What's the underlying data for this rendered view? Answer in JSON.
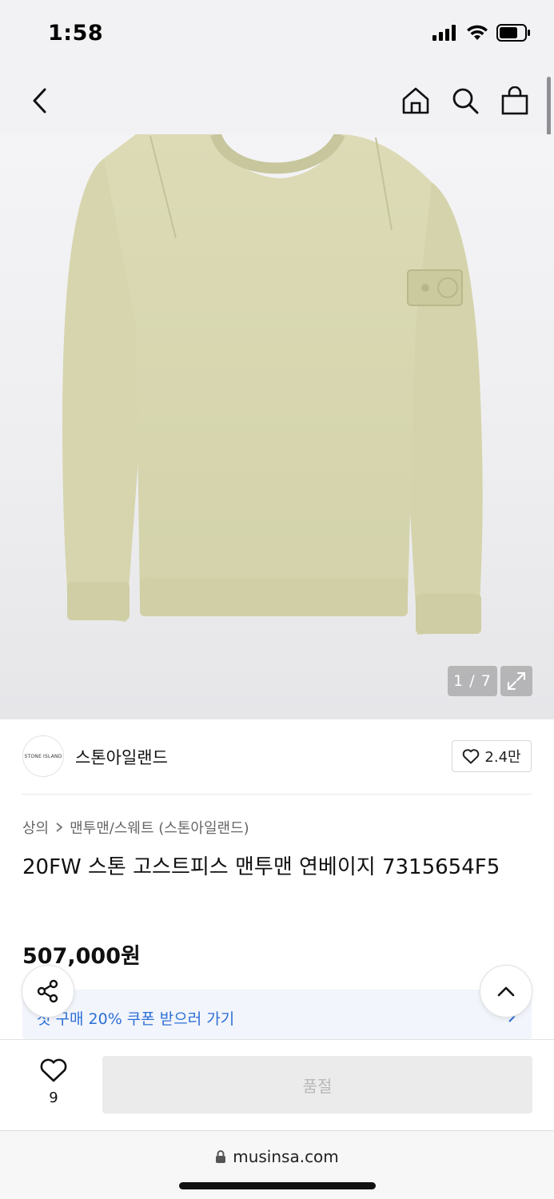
{
  "status": {
    "time": "1:58",
    "icons": [
      "signal-icon",
      "wifi-icon",
      "battery-icon"
    ]
  },
  "nav": {
    "icons": [
      "back-icon",
      "home-icon",
      "search-icon",
      "shopping-bag-icon"
    ]
  },
  "gallery": {
    "counter": "1 / 7",
    "current_image": 1,
    "total_images": 7,
    "product_color": "#dddcb8"
  },
  "brand": {
    "logo_text": "STONE ISLAND",
    "name": "스톤아일랜드",
    "likes": "2.4만"
  },
  "breadcrumb": {
    "category": "상의",
    "subcategory": "맨투맨/스웨트 (스톤아일랜드)"
  },
  "product": {
    "title": "20FW 스톤 고스트피스 맨투맨 연베이지 7315654F5",
    "price": "507,000원"
  },
  "coupon": {
    "text": "첫 구매 20% 쿠폰 받으러 가기"
  },
  "bottom": {
    "wish_count": "9",
    "buy_button": "품절"
  },
  "browser": {
    "url": "musinsa.com"
  },
  "colors": {
    "accent_blue": "#2c6fd6",
    "disabled_button": "#ebebeb",
    "disabled_text": "#b9b9b9"
  }
}
